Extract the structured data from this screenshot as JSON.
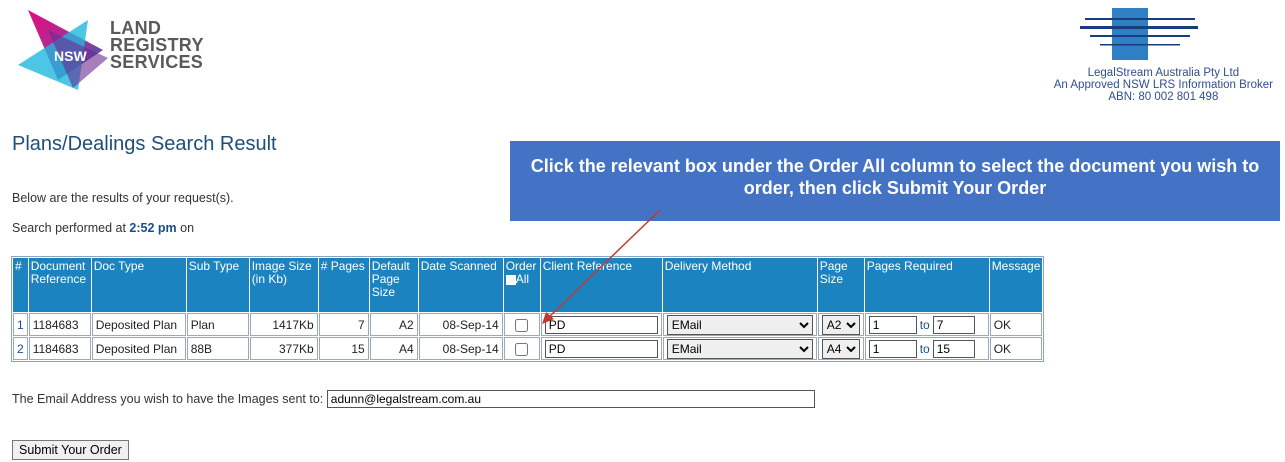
{
  "logo_nsw": {
    "badge": "NSW",
    "lines": [
      "LAND",
      "REGISTRY",
      "SERVICES"
    ]
  },
  "broker": {
    "line1": "LegalStream Australia Pty Ltd",
    "line2": "An Approved NSW LRS Information Broker",
    "line3": "ABN: 80 002 801 498"
  },
  "page_title": "Plans/Dealings Search Result",
  "intro_text": "Below are the results of your request(s).",
  "performed": {
    "prefix": "Search performed at ",
    "time": "2:52 pm",
    "suffix": " on"
  },
  "callout": "Click the relevant box under the Order All column to select the document you wish to order, then click Submit Your Order",
  "table": {
    "headers": {
      "hash": "#",
      "doc_ref": "Document Reference",
      "doc_type": "Doc Type",
      "sub_type": "Sub Type",
      "image_size": "Image Size (in Kb)",
      "pages": "# Pages",
      "default_page_size": "Default Page Size",
      "date_scanned": "Date Scanned",
      "order": "Order",
      "order_all": "All",
      "client_ref": "Client Reference",
      "delivery": "Delivery Method",
      "page_size": "Page Size",
      "pages_required": "Pages Required",
      "message": "Message"
    },
    "rows": [
      {
        "num": "1",
        "doc_ref": "1184683",
        "doc_type": "Deposited Plan",
        "sub_type": "Plan",
        "image_size": "1417Kb",
        "pages": "7",
        "default_size": "A2",
        "date": "08-Sep-14",
        "client_ref": "PD",
        "delivery": "EMail",
        "page_size": "A2",
        "from": "1",
        "to_label": "to",
        "to": "7",
        "message": "OK"
      },
      {
        "num": "2",
        "doc_ref": "1184683",
        "doc_type": "Deposited Plan",
        "sub_type": "88B",
        "image_size": "377Kb",
        "pages": "15",
        "default_size": "A4",
        "date": "08-Sep-14",
        "client_ref": "PD",
        "delivery": "EMail",
        "page_size": "A4",
        "from": "1",
        "to_label": "to",
        "to": "15",
        "message": "OK"
      }
    ]
  },
  "email": {
    "label": "The Email Address you wish to have the Images sent to:",
    "value": "adunn@legalstream.com.au"
  },
  "submit_label": "Submit Your Order",
  "colors": {
    "header_blue": "#1b84c0",
    "callout_blue": "#4472c4",
    "arrow_red": "#c0392b"
  }
}
